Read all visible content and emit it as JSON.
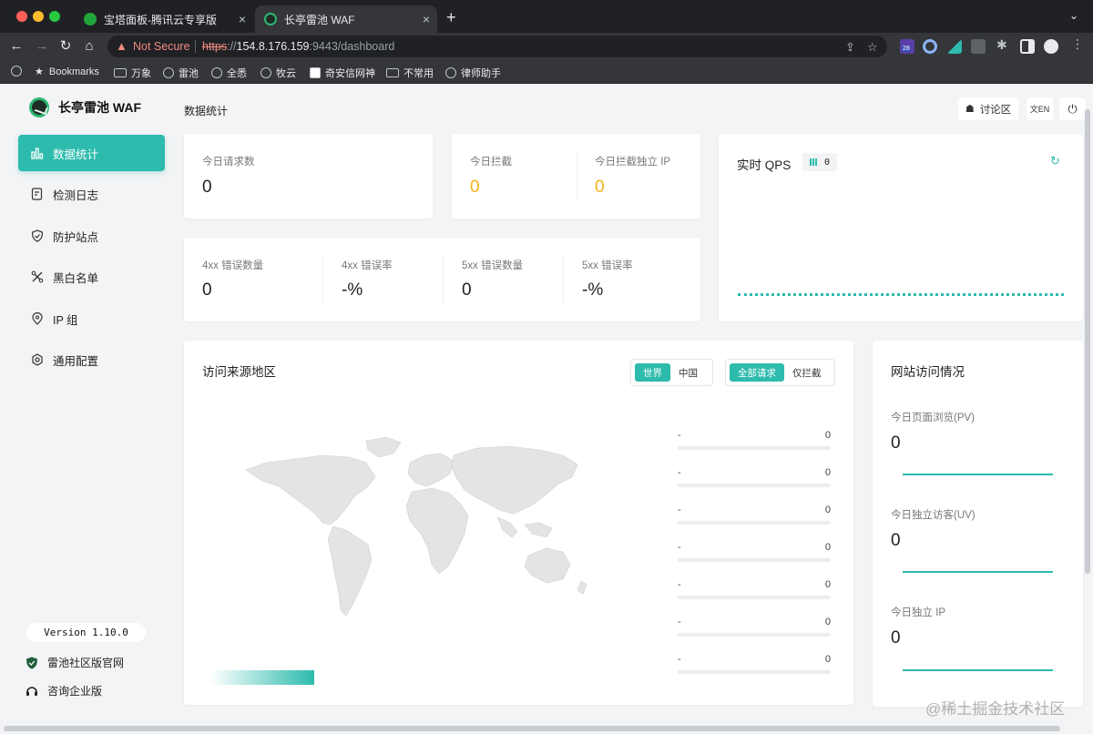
{
  "browser": {
    "tabs": [
      {
        "title": "宝塔面板-腾讯云专享版",
        "active": false
      },
      {
        "title": "长亭雷池 WAF",
        "active": true
      }
    ],
    "security_label": "Not Secure",
    "url": {
      "protocol": "https",
      "sep": "://",
      "host": "154.8.176.159",
      "path": ":9443/dashboard"
    },
    "extension_badge": "28",
    "bookmarks": [
      {
        "label": "Bookmarks",
        "icon": "star-icon"
      },
      {
        "label": "万象",
        "icon": "folder-icon"
      },
      {
        "label": "雷池",
        "icon": "site-icon"
      },
      {
        "label": "全悉",
        "icon": "site-icon"
      },
      {
        "label": "牧云",
        "icon": "site-icon"
      },
      {
        "label": "奇安信网神",
        "icon": "site-icon"
      },
      {
        "label": "不常用",
        "icon": "folder-icon"
      },
      {
        "label": "律师助手",
        "icon": "site-icon"
      }
    ]
  },
  "sidebar": {
    "brand": "长亭雷池 WAF",
    "items": [
      {
        "label": "数据统计",
        "icon": "bar-chart-icon",
        "active": true
      },
      {
        "label": "检测日志",
        "icon": "log-icon",
        "active": false
      },
      {
        "label": "防护站点",
        "icon": "shield-icon",
        "active": false
      },
      {
        "label": "黑白名单",
        "icon": "tools-icon",
        "active": false
      },
      {
        "label": "IP 组",
        "icon": "location-icon",
        "active": false
      },
      {
        "label": "通用配置",
        "icon": "gear-icon",
        "active": false
      }
    ],
    "version": "Version 1.10.0",
    "community_link": "雷池社区版官网",
    "enterprise_link": "咨询企业版"
  },
  "header": {
    "title": "数据统计",
    "forum_label": "讨论区",
    "lang_label": "文EN"
  },
  "stats": {
    "today_requests_label": "今日请求数",
    "today_requests": "0",
    "today_blocked_label": "今日拦截",
    "today_blocked": "0",
    "today_blocked_ip_label": "今日拦截独立 IP",
    "today_blocked_ip": "0",
    "err4xx_count_label": "4xx 错误数量",
    "err4xx_count": "0",
    "err4xx_rate_label": "4xx 错误率",
    "err4xx_rate": "-%",
    "err5xx_count_label": "5xx 错误数量",
    "err5xx_count": "0",
    "err5xx_rate_label": "5xx 错误率",
    "err5xx_rate": "-%"
  },
  "qps": {
    "title": "实时 QPS",
    "value": "0"
  },
  "region": {
    "title": "访问来源地区",
    "scope_options": [
      "世界",
      "中国"
    ],
    "scope_selected": "世界",
    "filter_options": [
      "全部请求",
      "仅拦截"
    ],
    "filter_selected": "全部请求",
    "ranking": [
      {
        "name": "-",
        "value": "0"
      },
      {
        "name": "-",
        "value": "0"
      },
      {
        "name": "-",
        "value": "0"
      },
      {
        "name": "-",
        "value": "0"
      },
      {
        "name": "-",
        "value": "0"
      },
      {
        "name": "-",
        "value": "0"
      },
      {
        "name": "-",
        "value": "0"
      }
    ]
  },
  "site": {
    "title": "网站访问情况",
    "pv_label": "今日页面浏览(PV)",
    "pv": "0",
    "uv_label": "今日独立访客(UV)",
    "uv": "0",
    "ip_label": "今日独立 IP",
    "ip": "0"
  },
  "watermark": "@稀土掘金技术社区",
  "colors": {
    "accent": "#2dbbad",
    "warning": "#f5b21b",
    "chrome_dark": "#202124",
    "chrome_mid": "#35363a"
  }
}
